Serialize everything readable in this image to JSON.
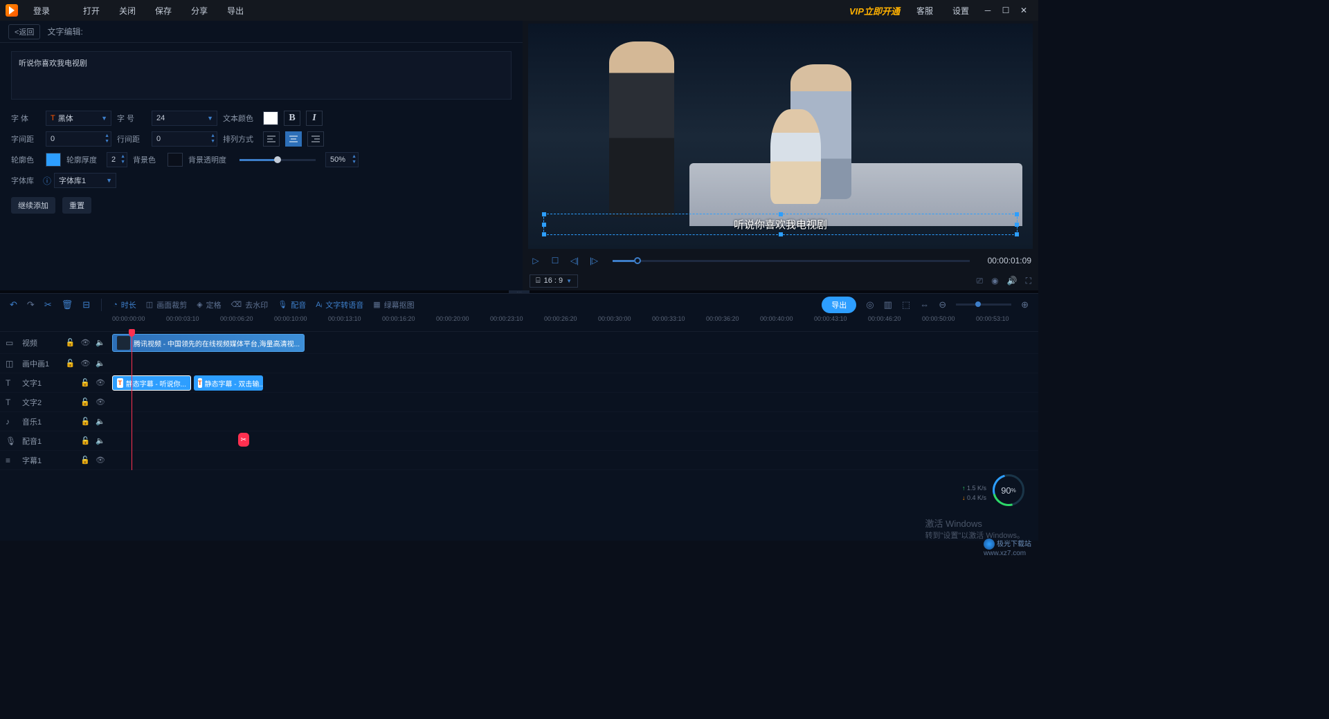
{
  "titlebar": {
    "login": "登录",
    "menu": [
      "打开",
      "关闭",
      "保存",
      "分享",
      "导出"
    ],
    "vip": "VIP立即开通",
    "right": [
      "客服",
      "设置"
    ]
  },
  "editor": {
    "back": "<返回",
    "title": "文字编辑:",
    "text_content": "听说你喜欢我电视剧",
    "font_label": "字  体",
    "font_value": "黑体",
    "size_label": "字  号",
    "size_value": "24",
    "color_label": "文本颜色",
    "text_color": "#ffffff",
    "letter_spacing_label": "字间距",
    "letter_spacing": "0",
    "line_spacing_label": "行间距",
    "line_spacing": "0",
    "align_label": "排列方式",
    "outline_color_label": "轮廓色",
    "outline_color": "#2d9eff",
    "outline_width_label": "轮廓厚度",
    "outline_width": "2",
    "bg_color_label": "背景色",
    "bg_color": "#0a0f1a",
    "bg_opacity_label": "背景透明度",
    "bg_opacity": "50%",
    "fontlib_label": "字体库",
    "fontlib_value": "字体库1",
    "btn_continue": "继续添加",
    "btn_reset": "重置"
  },
  "preview": {
    "caption": "听说你喜欢我电视剧",
    "time": "00:00:01:09",
    "ratio": "16 : 9"
  },
  "toolbar": {
    "duration": "时长",
    "crop": "画面裁剪",
    "freeze": "定格",
    "watermark": "去水印",
    "voice": "配音",
    "tts": "文字转语音",
    "green": "绿幕抠图",
    "export": "导出"
  },
  "ruler": [
    "00:00:00:00",
    "00:00:03:10",
    "00:00:06:20",
    "00:00:10:00",
    "00:00:13:10",
    "00:00:16:20",
    "00:00:20:00",
    "00:00:23:10",
    "00:00:26:20",
    "00:00:30:00",
    "00:00:33:10",
    "00:00:36:20",
    "00:00:40:00",
    "00:00:43:10",
    "00:00:46:20",
    "00:00:50:00",
    "00:00:53:10"
  ],
  "tracks": {
    "video": "视频",
    "pip": "画中画1",
    "text1": "文字1",
    "text2": "文字2",
    "music": "音乐1",
    "voice": "配音1",
    "subtitle": "字幕1"
  },
  "clips": {
    "video": "腾讯视频 - 中国领先的在线视频媒体平台,海量高清视...",
    "text1": "静态字幕 - 听说你...",
    "text2": "静态字幕 - 双击输..."
  },
  "perf": {
    "value": "90",
    "unit": "%",
    "up": "1.5 K/s",
    "down": "0.4 K/s"
  },
  "activate": {
    "title": "激活 Windows",
    "sub": "转到\"设置\"以激活 Windows。"
  },
  "watermark": {
    "name": "极光下载站",
    "url": "www.xz7.com"
  }
}
